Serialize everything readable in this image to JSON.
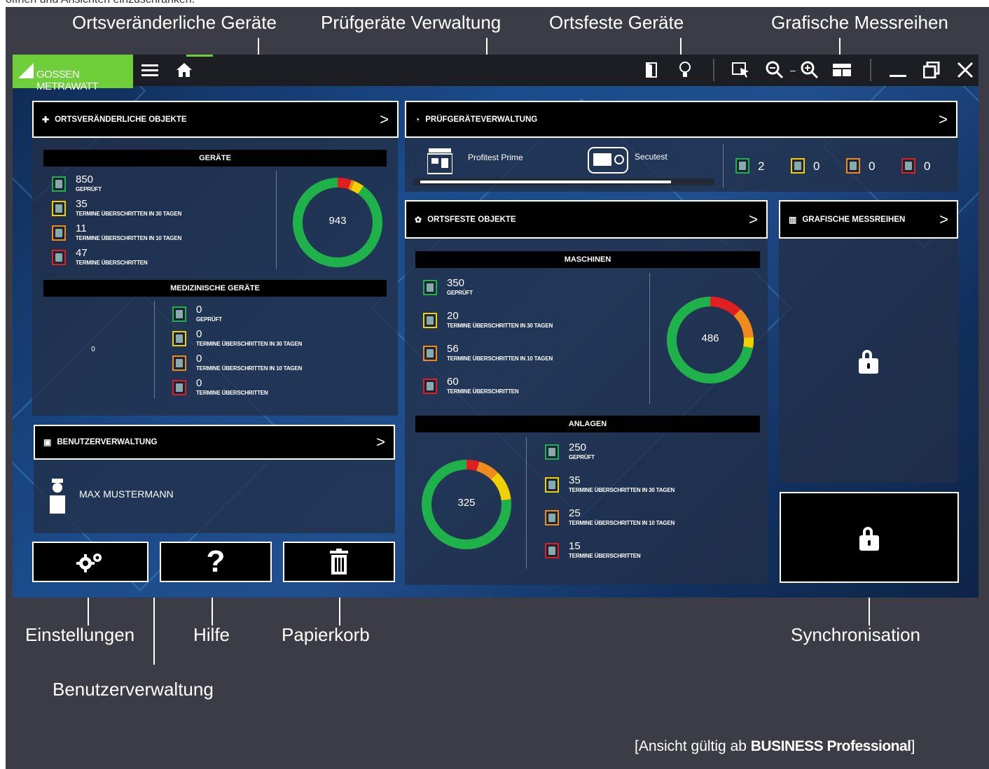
{
  "callouts": {
    "ortsveraenderliche": "Ortsveränderliche Geräte",
    "pruefgeraete": "Prüfgeräte Verwaltung",
    "ortsfeste": "Ortsfeste Geräte",
    "grafische": "Grafische Messreihen",
    "einstellungen": "Einstellungen",
    "hilfe": "Hilfe",
    "papierkorb": "Papierkorb",
    "benutzerverwaltung": "Benutzerverwaltung",
    "synchronisation": "Synchronisation"
  },
  "footer": {
    "prefix": "[Ansicht gültig ab ",
    "edition": "BUSINESS Professional",
    "suffix": "]"
  },
  "logo": "GOSSEN METRAWATT",
  "colors": {
    "green": "#1fb14a",
    "yellow": "#f2d000",
    "orange": "#f08a1c",
    "red": "#e02020",
    "logo": "#6fcf3a"
  },
  "ortsveraenderlich": {
    "title": "ORTSVERÄNDERLICHE OBJEKTE",
    "geraete": {
      "title": "GERÄTE",
      "total": "943",
      "stats": [
        {
          "value": "850",
          "label": "GEPRÜFT",
          "color": "#1fb14a"
        },
        {
          "value": "35",
          "label": "TERMINE ÜBERSCHRITTEN IN 30 TAGEN",
          "color": "#f2d000"
        },
        {
          "value": "11",
          "label": "TERMINE ÜBERSCHRITTEN IN 10 TAGEN",
          "color": "#f08a1c"
        },
        {
          "value": "47",
          "label": "TERMINE ÜBERSCHRITTEN",
          "color": "#e02020"
        }
      ]
    },
    "medizinisch": {
      "title": "MEDIZINISCHE GERÄTE",
      "total": "0",
      "stats": [
        {
          "value": "0",
          "label": "GEPRÜFT",
          "color": "#1fb14a"
        },
        {
          "value": "0",
          "label": "TERMINE ÜBERSCHRITTEN IN 30 TAGEN",
          "color": "#f2d000"
        },
        {
          "value": "0",
          "label": "TERMINE ÜBERSCHRITTEN IN 10 TAGEN",
          "color": "#f08a1c"
        },
        {
          "value": "0",
          "label": "TERMINE ÜBERSCHRITTEN",
          "color": "#e02020"
        }
      ]
    }
  },
  "pruef": {
    "title": "PRÜFGERÄTEVERWALTUNG",
    "devices": [
      {
        "name": "Profitest Prime"
      },
      {
        "name": "Secutest"
      }
    ],
    "counts": [
      {
        "value": "2",
        "color": "#1fb14a"
      },
      {
        "value": "0",
        "color": "#f2d000"
      },
      {
        "value": "0",
        "color": "#f08a1c"
      },
      {
        "value": "0",
        "color": "#e02020"
      }
    ]
  },
  "ortsfest": {
    "title": "ORTSFESTE OBJEKTE",
    "maschinen": {
      "title": "MASCHINEN",
      "total": "486",
      "stats": [
        {
          "value": "350",
          "label": "GEPRÜFT",
          "color": "#1fb14a"
        },
        {
          "value": "20",
          "label": "TERMINE ÜBERSCHRITTEN IN 30 TAGEN",
          "color": "#f2d000"
        },
        {
          "value": "56",
          "label": "TERMINE ÜBERSCHRITTEN IN 10 TAGEN",
          "color": "#f08a1c"
        },
        {
          "value": "60",
          "label": "TERMINE ÜBERSCHRITTEN",
          "color": "#e02020"
        }
      ]
    },
    "anlagen": {
      "title": "ANLAGEN",
      "total": "325",
      "stats": [
        {
          "value": "250",
          "label": "GEPRÜFT",
          "color": "#1fb14a"
        },
        {
          "value": "35",
          "label": "TERMINE ÜBERSCHRITTEN IN 30 TAGEN",
          "color": "#f2d000"
        },
        {
          "value": "25",
          "label": "TERMINE ÜBERSCHRITTEN IN 10 TAGEN",
          "color": "#f08a1c"
        },
        {
          "value": "15",
          "label": "TERMINE ÜBERSCHRITTEN",
          "color": "#e02020"
        }
      ]
    }
  },
  "grafisch": {
    "title": "GRAFISCHE MESSREIHEN"
  },
  "benutzer": {
    "title": "BENUTZERVERWALTUNG",
    "user": "MAX MUSTERMANN"
  },
  "buttons": {
    "settings_icon": "gear-icon",
    "help_glyph": "?",
    "trash_icon": "trash-icon"
  }
}
